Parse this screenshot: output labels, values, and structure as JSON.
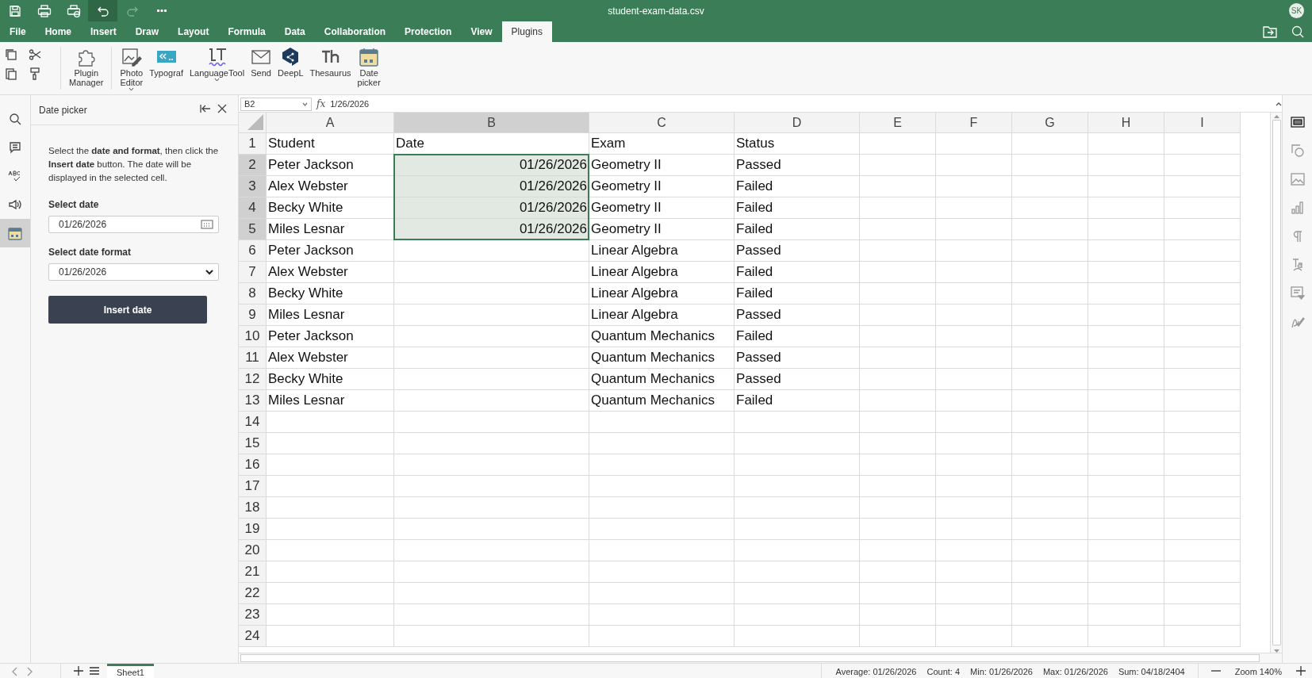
{
  "window": {
    "title": "student-exam-data.csv",
    "user_initials": "SK"
  },
  "quick_access": [
    {
      "kind": "save",
      "disabled": false
    },
    {
      "kind": "print",
      "disabled": false
    },
    {
      "kind": "quick-print",
      "disabled": false
    },
    {
      "kind": "undo",
      "disabled": false
    },
    {
      "kind": "redo",
      "disabled": true
    },
    {
      "kind": "more",
      "disabled": false
    }
  ],
  "menu_tabs": [
    {
      "label": "File",
      "selected": false
    },
    {
      "label": "Home",
      "selected": false
    },
    {
      "label": "Insert",
      "selected": false
    },
    {
      "label": "Draw",
      "selected": false
    },
    {
      "label": "Layout",
      "selected": false
    },
    {
      "label": "Formula",
      "selected": false
    },
    {
      "label": "Data",
      "selected": false
    },
    {
      "label": "Collaboration",
      "selected": false
    },
    {
      "label": "Protection",
      "selected": false
    },
    {
      "label": "View",
      "selected": false
    },
    {
      "label": "Plugins",
      "selected": true
    }
  ],
  "plugins": [
    {
      "kind": "plugin-manager",
      "label": "Plugin Manager",
      "dropdown": false
    },
    {
      "kind": "photo-editor",
      "label": "Photo Editor",
      "dropdown": true
    },
    {
      "kind": "typograf",
      "label": "Typograf",
      "dropdown": false
    },
    {
      "kind": "languagetool",
      "label": "LanguageTool",
      "dropdown": true
    },
    {
      "kind": "send",
      "label": "Send",
      "dropdown": false
    },
    {
      "kind": "deepl",
      "label": "DeepL",
      "dropdown": false
    },
    {
      "kind": "thesaurus",
      "label": "Thesaurus",
      "dropdown": false
    },
    {
      "kind": "date-picker",
      "label": "Date picker",
      "dropdown": false
    }
  ],
  "left_rail": [
    {
      "kind": "search",
      "selected": false
    },
    {
      "kind": "comment",
      "selected": false
    },
    {
      "kind": "spelling",
      "selected": false
    },
    {
      "kind": "speaker",
      "selected": false
    },
    {
      "kind": "calendar",
      "selected": true
    }
  ],
  "side_panel": {
    "title": "Date picker",
    "description": "Select the **date and format**, then click the **Insert date** button. The date will be displayed in the selected cell.",
    "date_label": "Select date",
    "date_value": "01/26/2026",
    "format_label": "Select date format",
    "format_value": "01/26/2026",
    "button": "Insert date"
  },
  "formula_bar": {
    "cell": "B2",
    "fx": "fx",
    "value": "1/26/2026"
  },
  "columns": [
    {
      "label": "A",
      "selected": false
    },
    {
      "label": "B",
      "selected": true
    },
    {
      "label": "C",
      "selected": false
    },
    {
      "label": "D",
      "selected": false
    },
    {
      "label": "E",
      "selected": false
    },
    {
      "label": "F",
      "selected": false
    },
    {
      "label": "G",
      "selected": false
    },
    {
      "label": "H",
      "selected": false
    },
    {
      "label": "I",
      "selected": false
    }
  ],
  "rows": [
    {
      "number": "1",
      "selected": false,
      "cells": [
        "Student",
        "Date",
        "Exam",
        "Status"
      ]
    },
    {
      "number": "2",
      "selected": true,
      "cells": [
        "Peter Jackson",
        "01/26/2026",
        "Geometry II",
        "Passed"
      ]
    },
    {
      "number": "3",
      "selected": true,
      "cells": [
        "Alex Webster",
        "01/26/2026",
        "Geometry II",
        "Failed"
      ]
    },
    {
      "number": "4",
      "selected": true,
      "cells": [
        "Becky White",
        "01/26/2026",
        "Geometry II",
        "Failed"
      ]
    },
    {
      "number": "5",
      "selected": true,
      "cells": [
        "Miles Lesnar",
        "01/26/2026",
        "Geometry II",
        "Failed"
      ]
    },
    {
      "number": "6",
      "selected": false,
      "cells": [
        "Peter Jackson",
        "",
        "Linear Algebra",
        "Passed"
      ]
    },
    {
      "number": "7",
      "selected": false,
      "cells": [
        "Alex Webster",
        "",
        "Linear Algebra",
        "Failed"
      ]
    },
    {
      "number": "8",
      "selected": false,
      "cells": [
        "Becky White",
        "",
        "Linear Algebra",
        "Failed"
      ]
    },
    {
      "number": "9",
      "selected": false,
      "cells": [
        "Miles Lesnar",
        "",
        "Linear Algebra",
        "Passed"
      ]
    },
    {
      "number": "10",
      "selected": false,
      "cells": [
        "Peter Jackson",
        "",
        "Quantum Mechanics",
        "Failed"
      ]
    },
    {
      "number": "11",
      "selected": false,
      "cells": [
        "Alex Webster",
        "",
        "Quantum Mechanics",
        "Passed"
      ]
    },
    {
      "number": "12",
      "selected": false,
      "cells": [
        "Becky White",
        "",
        "Quantum Mechanics",
        "Passed"
      ]
    },
    {
      "number": "13",
      "selected": false,
      "cells": [
        "Miles Lesnar",
        "",
        "Quantum Mechanics",
        "Failed"
      ]
    },
    {
      "number": "14",
      "selected": false,
      "cells": []
    },
    {
      "number": "15",
      "selected": false,
      "cells": []
    },
    {
      "number": "16",
      "selected": false,
      "cells": []
    },
    {
      "number": "17",
      "selected": false,
      "cells": []
    },
    {
      "number": "18",
      "selected": false,
      "cells": []
    },
    {
      "number": "19",
      "selected": false,
      "cells": []
    },
    {
      "number": "20",
      "selected": false,
      "cells": []
    },
    {
      "number": "21",
      "selected": false,
      "cells": []
    },
    {
      "number": "22",
      "selected": false,
      "cells": []
    },
    {
      "number": "23",
      "selected": false,
      "cells": []
    },
    {
      "number": "24",
      "selected": false,
      "cells": []
    }
  ],
  "right_rail": [
    {
      "kind": "cell-settings",
      "selected": true
    },
    {
      "kind": "shape",
      "selected": false
    },
    {
      "kind": "image",
      "selected": false
    },
    {
      "kind": "chart",
      "selected": false
    },
    {
      "kind": "paragraph",
      "selected": false
    },
    {
      "kind": "text-art",
      "selected": false
    },
    {
      "kind": "pivot",
      "selected": false
    },
    {
      "kind": "signature",
      "selected": false
    }
  ],
  "sheet_tabs": [
    {
      "label": "Sheet1",
      "selected": true
    }
  ],
  "status_bar": {
    "stats": [
      "Average: 01/26/2026",
      "Count: 4",
      "Min: 01/26/2026",
      "Max: 01/26/2026",
      "Sum: 04/18/2404"
    ],
    "zoom": "Zoom 140%"
  }
}
